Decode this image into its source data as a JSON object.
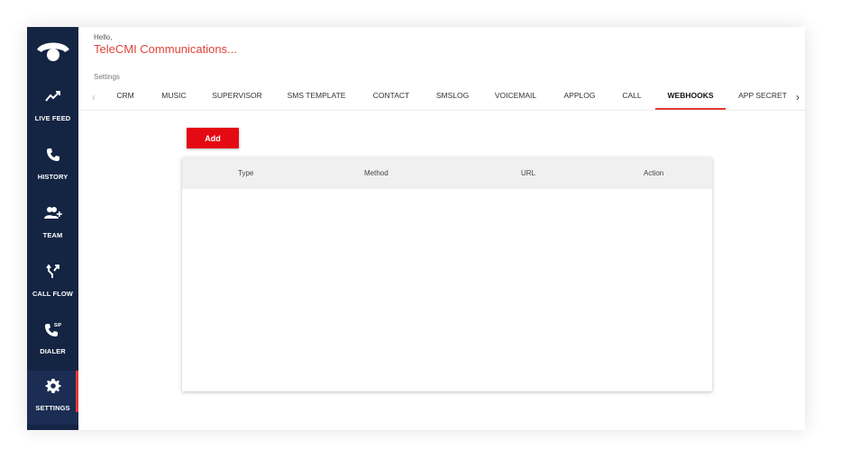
{
  "sidebar": {
    "logo": "phone-logo-icon",
    "items": [
      {
        "label": "LIVE FEED",
        "icon": "trending-up-icon"
      },
      {
        "label": "HISTORY",
        "icon": "phone-icon"
      },
      {
        "label": "TEAM",
        "icon": "group-add-icon"
      },
      {
        "label": "CALL FLOW",
        "icon": "call-split-icon"
      },
      {
        "label": "DIALER",
        "icon": "sip-phone-icon"
      },
      {
        "label": "SETTINGS",
        "icon": "gear-icon",
        "active": true
      }
    ],
    "active_color": "#e53935",
    "bg_color": "#142443"
  },
  "header": {
    "greeting": "Hello,",
    "company": "TeleCMI Communications..."
  },
  "section_label": "Settings",
  "tabs": [
    {
      "label": "CRM"
    },
    {
      "label": "MUSIC"
    },
    {
      "label": "SUPERVISOR"
    },
    {
      "label": "SMS TEMPLATE"
    },
    {
      "label": "CONTACT"
    },
    {
      "label": "SMSLOG"
    },
    {
      "label": "VOICEMAIL"
    },
    {
      "label": "APPLOG"
    },
    {
      "label": "CALL"
    },
    {
      "label": "WEBHOOKS",
      "active": true
    },
    {
      "label": "APP SECRET"
    }
  ],
  "add_button": "Add",
  "table": {
    "columns": [
      "Type",
      "Method",
      "URL",
      "Action"
    ],
    "rows": []
  }
}
